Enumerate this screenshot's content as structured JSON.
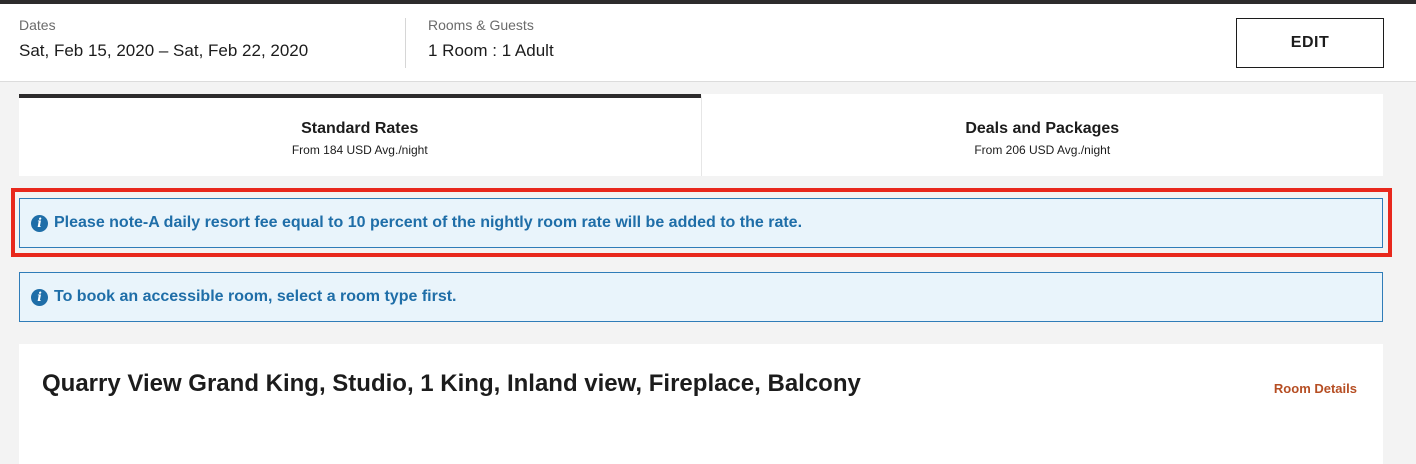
{
  "search_summary": {
    "dates_label": "Dates",
    "dates_value": "Sat, Feb 15, 2020 – Sat, Feb 22, 2020",
    "rooms_label": "Rooms & Guests",
    "rooms_value": "1 Room : 1 Adult",
    "edit_label": "EDIT"
  },
  "rate_tabs": [
    {
      "title": "Standard Rates",
      "subtitle": "From 184 USD Avg./night",
      "active": true
    },
    {
      "title": "Deals and Packages",
      "subtitle": "From 206 USD Avg./night",
      "active": false
    }
  ],
  "notices": [
    {
      "text": "Please note-A daily resort fee equal to 10 percent of the nightly room rate will be added to the rate.",
      "icon": "info-icon"
    },
    {
      "text": "To book an accessible room, select a room type first.",
      "icon": "info-icon"
    }
  ],
  "room": {
    "title": "Quarry View Grand King, Studio, 1 King, Inland view, Fireplace, Balcony",
    "details_link": "Room Details"
  },
  "colors": {
    "header_strip": "#2d2b2c",
    "notice_text": "#1f6ea8",
    "notice_bg": "#e9f4fb",
    "highlight": "#e8281c",
    "link": "#b64e23"
  }
}
